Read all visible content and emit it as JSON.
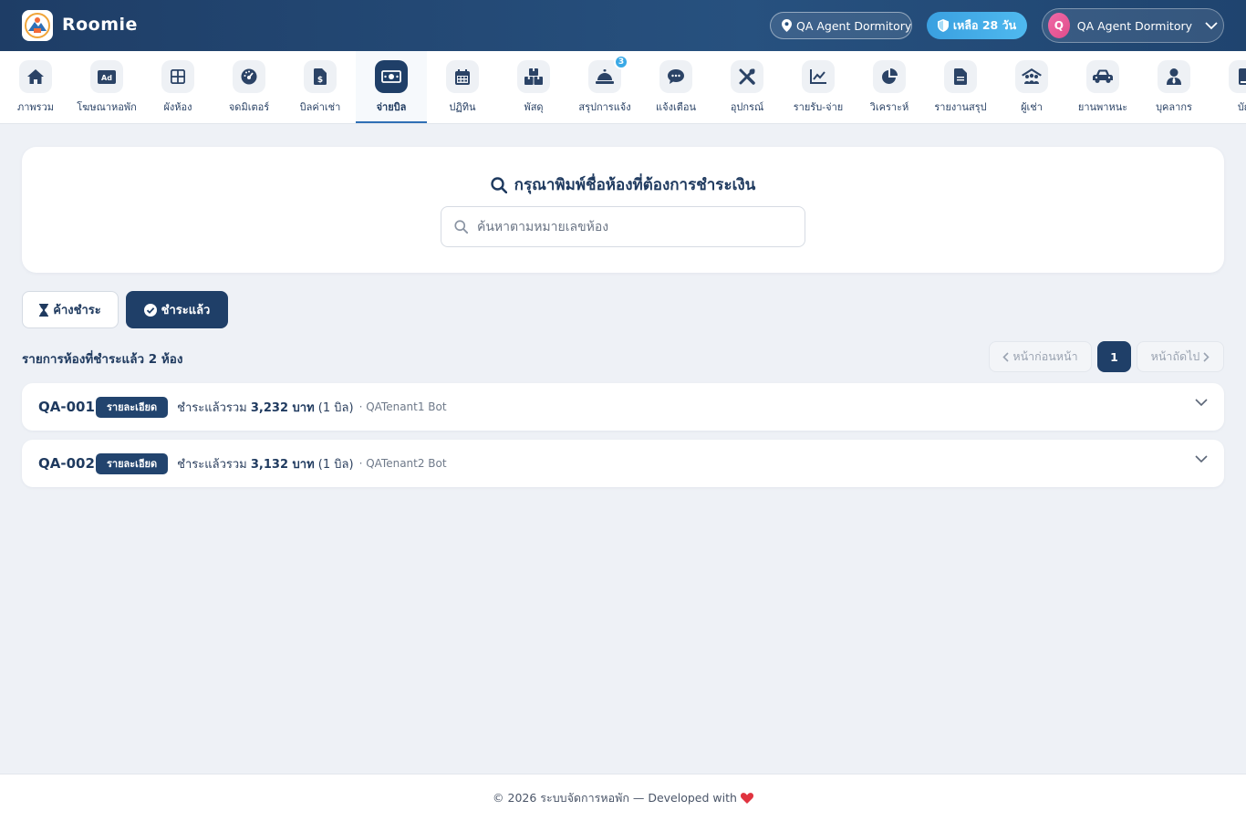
{
  "header": {
    "brand": "Roomie",
    "location_label": "QA Agent Dormitory",
    "days_left_label": "เหลือ 28 วัน",
    "user_initial": "Q",
    "user_name": "QA Agent Dormitory"
  },
  "nav": {
    "items": [
      {
        "label": "ภาพรวม",
        "icon": "home-icon"
      },
      {
        "label": "โฆษณาหอพัก",
        "icon": "ad-icon"
      },
      {
        "label": "ผังห้อง",
        "icon": "grid-icon"
      },
      {
        "label": "จดมิเตอร์",
        "icon": "gauge-icon"
      },
      {
        "label": "บิลค่าเช่า",
        "icon": "invoice-icon"
      },
      {
        "label": "จ่ายบิล",
        "icon": "money-icon",
        "active": true
      },
      {
        "label": "ปฏิทิน",
        "icon": "calendar-icon"
      },
      {
        "label": "พัสดุ",
        "icon": "boxes-icon"
      },
      {
        "label": "สรุปการแจ้ง",
        "icon": "bell-service-icon",
        "badge": "3"
      },
      {
        "label": "แจ้งเตือน",
        "icon": "chat-icon"
      },
      {
        "label": "อุปกรณ์",
        "icon": "tools-icon"
      },
      {
        "label": "รายรับ-จ่าย",
        "icon": "line-chart-icon"
      },
      {
        "label": "วิเคราะห์",
        "icon": "pie-chart-icon"
      },
      {
        "label": "รายงานสรุป",
        "icon": "document-icon"
      },
      {
        "label": "ผู้เช่า",
        "icon": "people-roof-icon"
      },
      {
        "label": "ยานพาหนะ",
        "icon": "car-icon"
      },
      {
        "label": "บุคลากร",
        "icon": "user-tie-icon"
      },
      {
        "label": "บัญ",
        "icon": "book-icon"
      }
    ]
  },
  "search": {
    "title": "กรุณาพิมพ์ชื่อห้องที่ต้องการชำระเงิน",
    "placeholder": "ค้นหาตามหมายเลขห้อง",
    "value": ""
  },
  "filters": {
    "pending_label": "ค้างชำระ",
    "paid_label": "ชำระแล้ว",
    "active": "paid"
  },
  "summary": "รายการห้องที่ชำระแล้ว 2 ห้อง",
  "pagination": {
    "prev_label": "หน้าก่อนหน้า",
    "current_page": "1",
    "next_label": "หน้าถัดไป"
  },
  "rooms": [
    {
      "name": "QA-001",
      "detail_label": "รายละเอียด",
      "paid_prefix": "ชำระแล้วรวม",
      "amount": "3,232 บาท",
      "bills": "(1 บิล)",
      "tenant": "· QATenant1 Bot"
    },
    {
      "name": "QA-002",
      "detail_label": "รายละเอียด",
      "paid_prefix": "ชำระแล้วรวม",
      "amount": "3,132 บาท",
      "bills": "(1 บิล)",
      "tenant": "· QATenant2 Bot"
    }
  ],
  "footer": {
    "text": "© 2026 ระบบจัดการหอพัก — Developed with"
  },
  "colors": {
    "primary": "#1f3f68",
    "accent": "#3aa0e0",
    "heart": "#e0333f"
  }
}
